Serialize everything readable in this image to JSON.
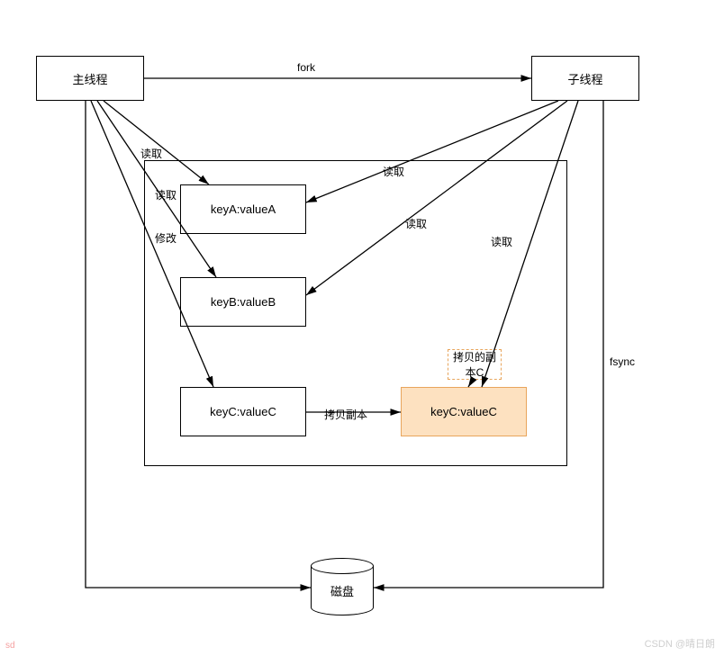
{
  "nodes": {
    "main_thread": "主线程",
    "child_thread": "子线程",
    "keyA": "keyA:valueA",
    "keyB": "keyB:valueB",
    "keyC": "keyC:valueC",
    "keyC_copy": "keyC:valueC",
    "copy_c_note": "拷贝的副\n本C",
    "disk": "磁盘"
  },
  "edges": {
    "fork": "fork",
    "read1": "读取",
    "read2": "读取",
    "modify": "修改",
    "read_r1": "读取",
    "read_r2": "读取",
    "read_r3": "读取",
    "copy_label": "拷贝副本",
    "fsync": "fsync"
  },
  "watermark": {
    "left": "sd",
    "right": "CSDN @晴日朗"
  }
}
